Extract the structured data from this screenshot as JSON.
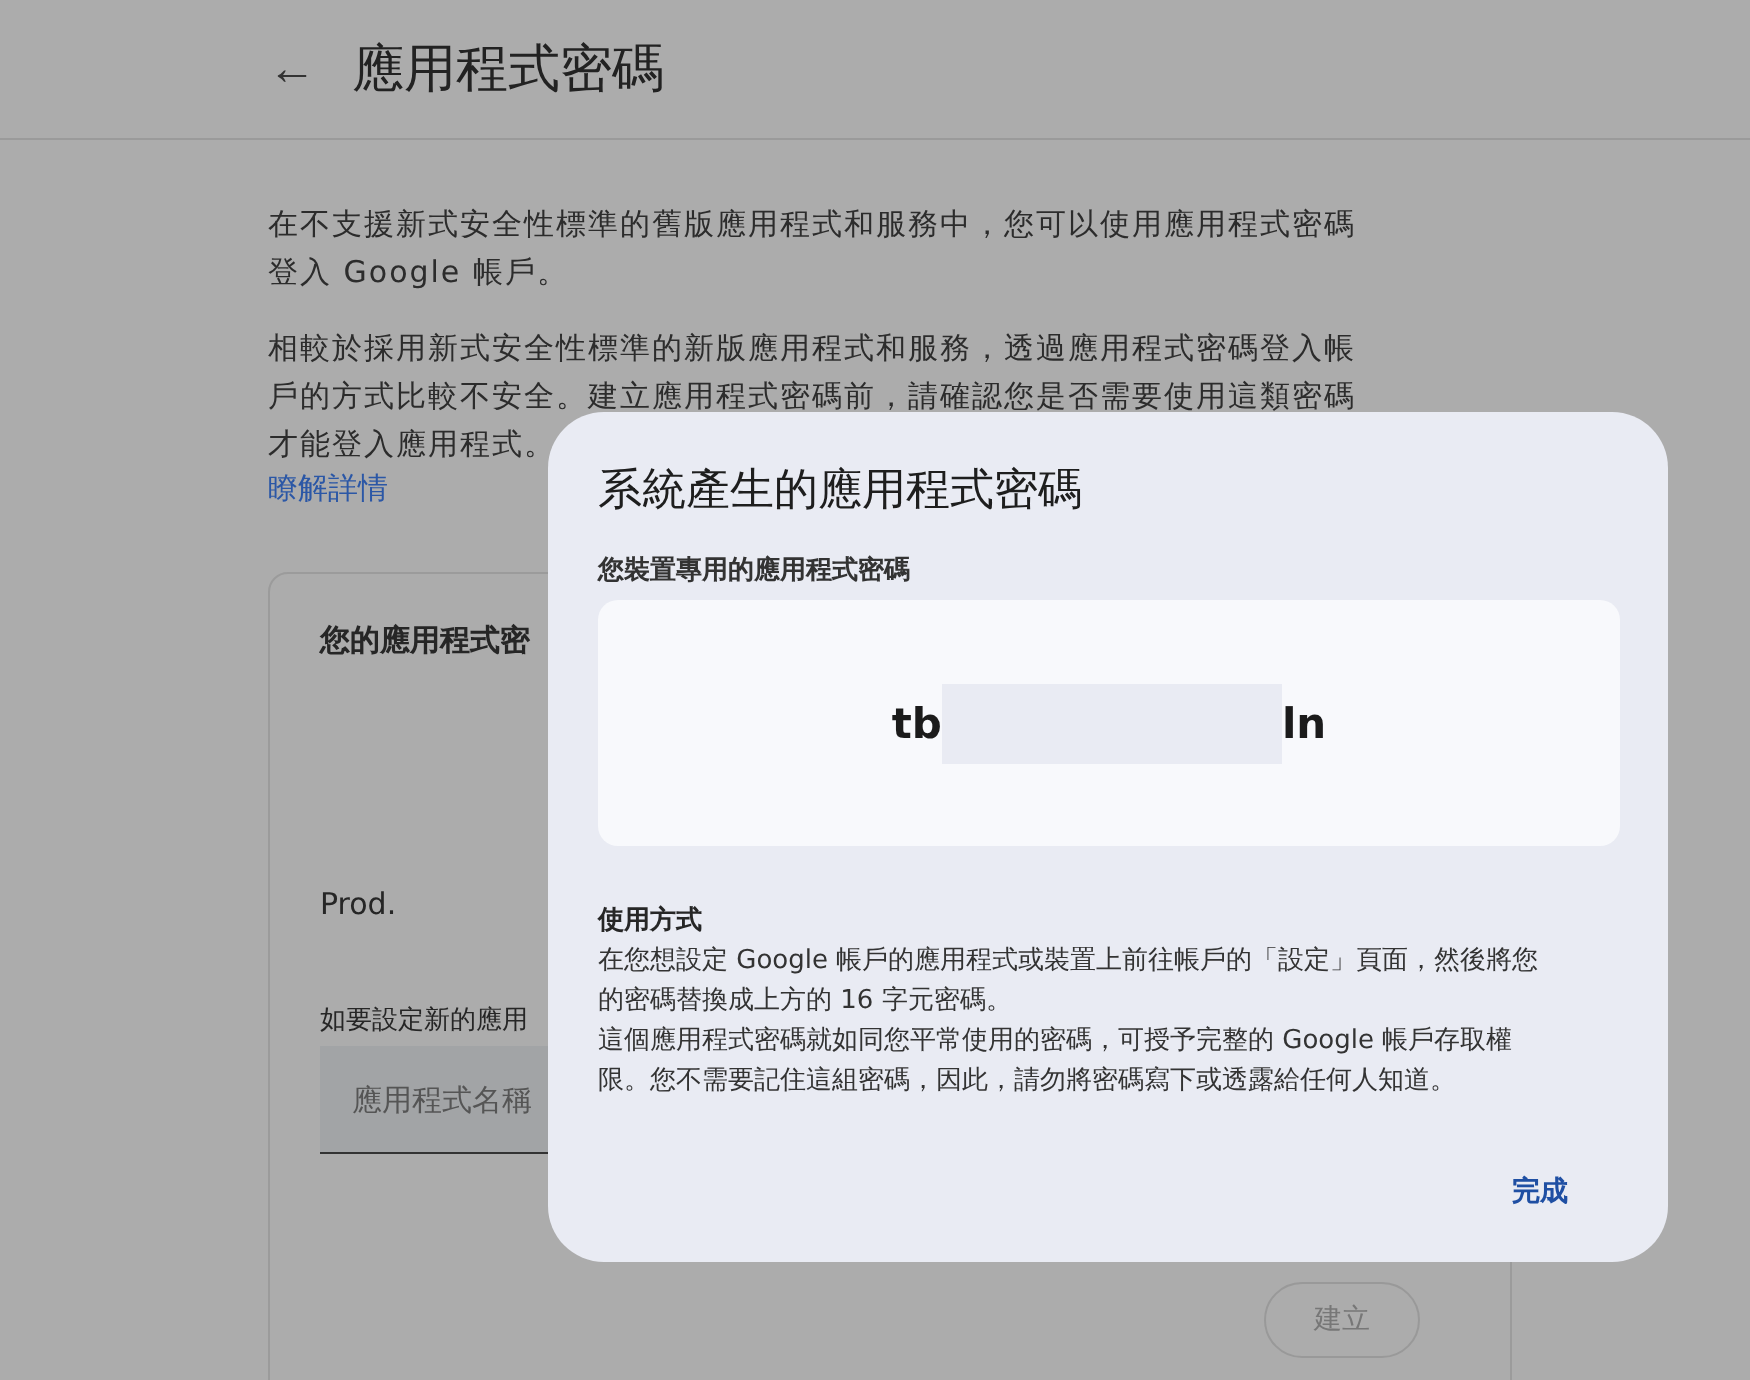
{
  "header": {
    "back_icon": "←",
    "title": "應用程式密碼"
  },
  "intro": [
    "在不支援新式安全性標準的舊版應用程式和服務中，您可以使用應用程式密碼登入 Google 帳戶。",
    "相較於採用新式安全性標準的新版應用程式和服務，透過應用程式密碼登入帳戶的方式比較不安全。建立應用程式密碼前，請確認您是否需要使用這類密碼才能登入應用程式。"
  ],
  "learn_more_link": "瞭解詳情",
  "card": {
    "title": "您的應用程式密",
    "app_name": "Prod.",
    "new_label": "如要設定新的應用",
    "name_field": {
      "placeholder": "應用程式名稱"
    },
    "create_button": {
      "label": "建立",
      "disabled": true
    }
  },
  "dialog": {
    "title": "系統產生的應用程式密碼",
    "password_label": "您裝置專用的應用程式密碼",
    "password_parts": [
      "tb",
      "ln"
    ],
    "usage_title": "使用方式",
    "usage_text": [
      "在您想設定 Google 帳戶的應用程式或裝置上前往帳戶的「設定」頁面，然後將您的密碼替換成上方的 16 字元密碼。",
      "這個應用程式密碼就如同您平常使用的密碼，可授予完整的 Google 帳戶存取權限。您不需要記住這組密碼，因此，請勿將密碼寫下或透露給任何人知道。"
    ],
    "done_button": "完成"
  }
}
